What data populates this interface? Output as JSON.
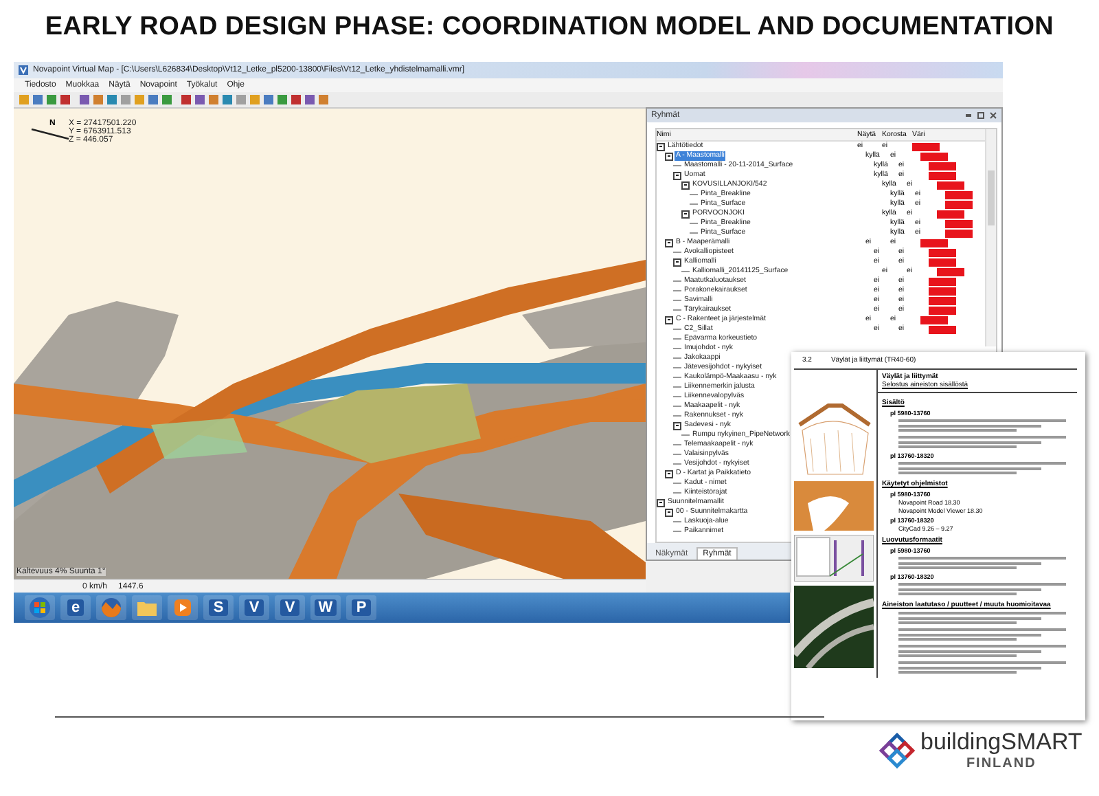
{
  "slide_title": "EARLY ROAD DESIGN PHASE: COORDINATION MODEL AND DOCUMENTATION",
  "app_window": {
    "title": "Novapoint Virtual Map - [C:\\Users\\L626834\\Desktop\\Vt12_Letke_pl5200-13800\\Files\\Vt12_Letke_yhdistelmamalli.vmr]",
    "menu": [
      "Tiedosto",
      "Muokkaa",
      "Näytä",
      "Novapoint",
      "Työkalut",
      "Ohje"
    ],
    "north_label": "N",
    "coordinates": [
      "X = 27417501.220",
      "Y = 6763911.513",
      "Z = 446.057"
    ],
    "status_overlay": "Kaltevuus 4% Suunta 1°",
    "status_bar": [
      "0 km/h",
      "1447.6"
    ]
  },
  "taskbar": [
    {
      "kind": "orb"
    },
    {
      "kind": "letter",
      "glyph": "e"
    },
    {
      "kind": "fox"
    },
    {
      "kind": "folder"
    },
    {
      "kind": "player"
    },
    {
      "kind": "letter",
      "glyph": "S"
    },
    {
      "kind": "letter",
      "glyph": "V"
    },
    {
      "kind": "letter",
      "glyph": "V"
    },
    {
      "kind": "letter",
      "glyph": "W"
    },
    {
      "kind": "letter",
      "glyph": "P"
    }
  ],
  "groups_panel": {
    "title": "Ryhmät",
    "columns": [
      "Nimi",
      "Näytä",
      "Korosta",
      "Väri"
    ],
    "rows": [
      {
        "name": "Lähtötiedot",
        "show": "ei",
        "highlight": "ei",
        "color": "#e8141c",
        "selected": false,
        "expanded": true,
        "children": [
          {
            "name": "A - Maastomalli",
            "show": "kyllä",
            "highlight": "ei",
            "color": "#e8141c",
            "selected": true,
            "expanded": true,
            "children": [
              {
                "name": "Maastomalli - 20-11-2014_Surface",
                "show": "kyllä",
                "highlight": "ei",
                "color": "#e8141c",
                "selected": false
              },
              {
                "name": "Uomat",
                "show": "kyllä",
                "highlight": "ei",
                "color": "#e8141c",
                "selected": false,
                "expanded": true,
                "children": [
                  {
                    "name": "KOVUSILLANJOKI/542",
                    "show": "kyllä",
                    "highlight": "ei",
                    "color": "#e8141c",
                    "selected": false,
                    "expanded": true,
                    "children": [
                      {
                        "name": "Pinta_Breakline",
                        "show": "kyllä",
                        "highlight": "ei",
                        "color": "#e8141c",
                        "selected": false
                      },
                      {
                        "name": "Pinta_Surface",
                        "show": "kyllä",
                        "highlight": "ei",
                        "color": "#e8141c",
                        "selected": false
                      }
                    ]
                  },
                  {
                    "name": "PORVOONJOKI",
                    "show": "kyllä",
                    "highlight": "ei",
                    "color": "#e8141c",
                    "selected": false,
                    "expanded": true,
                    "children": [
                      {
                        "name": "Pinta_Breakline",
                        "show": "kyllä",
                        "highlight": "ei",
                        "color": "#e8141c",
                        "selected": false
                      },
                      {
                        "name": "Pinta_Surface",
                        "show": "kyllä",
                        "highlight": "ei",
                        "color": "#e8141c",
                        "selected": false
                      }
                    ]
                  }
                ]
              }
            ]
          },
          {
            "name": "B - Maaperämalli",
            "show": "ei",
            "highlight": "ei",
            "color": "#e8141c",
            "selected": false,
            "expanded": true,
            "children": [
              {
                "name": "Avokalliopisteet",
                "show": "ei",
                "highlight": "ei",
                "color": "#e8141c",
                "selected": false
              },
              {
                "name": "Kalliomalli",
                "show": "ei",
                "highlight": "ei",
                "color": "#e8141c",
                "selected": false,
                "expanded": true,
                "children": [
                  {
                    "name": "Kalliomalli_20141125_Surface",
                    "show": "ei",
                    "highlight": "ei",
                    "color": "#e8141c",
                    "selected": false
                  }
                ]
              },
              {
                "name": "Maatutkaluotaukset",
                "show": "ei",
                "highlight": "ei",
                "color": "#e8141c",
                "selected": false
              },
              {
                "name": "Porakonekairaukset",
                "show": "ei",
                "highlight": "ei",
                "color": "#e8141c",
                "selected": false
              },
              {
                "name": "Savimalli",
                "show": "ei",
                "highlight": "ei",
                "color": "#e8141c",
                "selected": false
              },
              {
                "name": "Tärykairaukset",
                "show": "ei",
                "highlight": "ei",
                "color": "#e8141c",
                "selected": false
              }
            ]
          },
          {
            "name": "C - Rakenteet ja järjestelmät",
            "show": "ei",
            "highlight": "ei",
            "color": "#e8141c",
            "selected": false,
            "expanded": true,
            "children": [
              {
                "name": "C2_Sillat",
                "show": "ei",
                "highlight": "ei",
                "color": "#e8141c",
                "selected": false
              },
              {
                "name": "Epävarma korkeustieto",
                "selected": false
              },
              {
                "name": "Imujohdot - nyk",
                "selected": false
              },
              {
                "name": "Jakokaappi",
                "selected": false
              },
              {
                "name": "Jätevesijohdot - nykyiset",
                "selected": false
              },
              {
                "name": "Kaukolämpö-Maakaasu - nyk",
                "selected": false
              },
              {
                "name": "Liikennemerkin jalusta",
                "selected": false
              },
              {
                "name": "Liikennevalopylväs",
                "selected": false
              },
              {
                "name": "Maakaapelit - nyk",
                "selected": false
              },
              {
                "name": "Rakennukset - nyk",
                "selected": false
              },
              {
                "name": "Sadevesi - nyk",
                "selected": false,
                "expanded": true,
                "children": [
                  {
                    "name": "Rumpu nykyinen_PipeNetwork",
                    "selected": false
                  }
                ]
              },
              {
                "name": "Telemaakaapelit - nyk",
                "selected": false
              },
              {
                "name": "Valaisinpylväs",
                "selected": false
              },
              {
                "name": "Vesijohdot - nykyiset",
                "selected": false
              }
            ]
          },
          {
            "name": "D - Kartat ja Paikkatieto",
            "selected": false,
            "expanded": true,
            "children": [
              {
                "name": "Kadut - nimet",
                "selected": false
              },
              {
                "name": "Kiinteistörajat",
                "selected": false
              }
            ]
          }
        ]
      },
      {
        "name": "Suunnitelmamallit",
        "selected": false,
        "expanded": true,
        "children": [
          {
            "name": "00 - Suunnitelmakartta",
            "selected": false,
            "expanded": true,
            "children": [
              {
                "name": "Laskuoja-alue",
                "selected": false
              },
              {
                "name": "Paikannimet",
                "selected": false
              }
            ]
          }
        ]
      }
    ],
    "tabs": [
      {
        "label": "Näkymät",
        "selected": false
      },
      {
        "label": "Ryhmät",
        "selected": true
      }
    ]
  },
  "document": {
    "section_number": "3.2",
    "section_title": "Väylät ja liittymät (TR40-60)",
    "header_title": "Väylät ja liittymät",
    "header_subtitle": "Selostus aineiston sisällöstä",
    "sections": [
      {
        "heading": "Sisältö",
        "items": [
          {
            "kind": "sub",
            "text": "pl 5980-13760"
          },
          {
            "kind": "lines"
          },
          {
            "kind": "lines"
          },
          {
            "kind": "sub",
            "text": "pl 13760-18320"
          },
          {
            "kind": "lines"
          }
        ]
      },
      {
        "heading": "Käytetyt ohjelmistot",
        "items": [
          {
            "kind": "sub",
            "text": "pl 5980-13760"
          },
          {
            "kind": "bullet",
            "text": "Novapoint Road 18.30"
          },
          {
            "kind": "bullet",
            "text": "Novapoint Model Viewer 18.30"
          },
          {
            "kind": "sub",
            "text": "pl 13760-18320"
          },
          {
            "kind": "bullet",
            "text": "CityCad 9.26 – 9.27"
          }
        ]
      },
      {
        "heading": "Luovutusformaatit",
        "items": [
          {
            "kind": "sub",
            "text": "pl 5980-13760"
          },
          {
            "kind": "lines"
          },
          {
            "kind": "sub",
            "text": "pl 13760-18320"
          },
          {
            "kind": "lines"
          }
        ]
      },
      {
        "heading": "Aineiston laatutaso / puutteet / muuta huomioitavaa",
        "items": [
          {
            "kind": "lines"
          },
          {
            "kind": "lines"
          },
          {
            "kind": "lines"
          },
          {
            "kind": "lines"
          }
        ]
      }
    ]
  },
  "logo": {
    "name": "buildingSMART",
    "country": "FINLAND"
  }
}
